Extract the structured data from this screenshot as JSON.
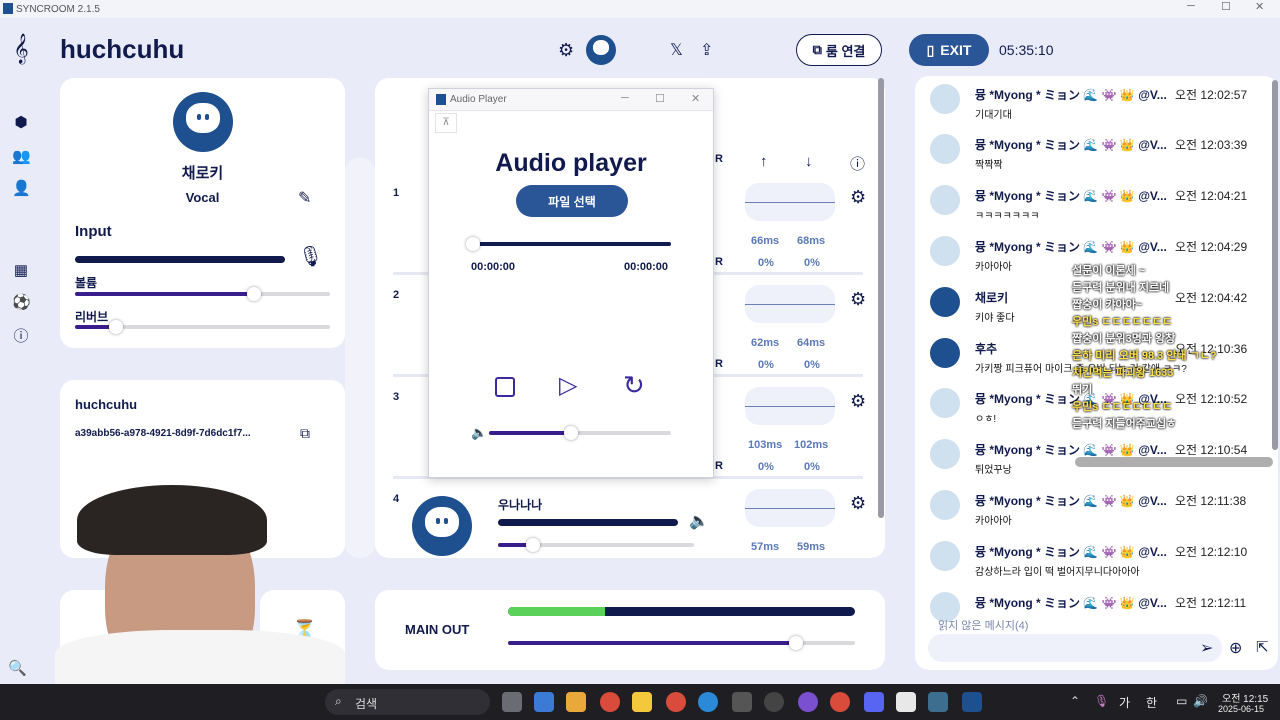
{
  "window": {
    "title": "SYNCROOM 2.1.5",
    "minimize": "─",
    "maximize": "☐",
    "close": "✕"
  },
  "header": {
    "room_name": "huchcuhu",
    "room_connect_label": "룸 연결",
    "exit_label": "EXIT",
    "elapsed_time": "05:35:10"
  },
  "sidebar": {
    "icons": [
      "cube-icon",
      "users-icon",
      "user-icon",
      "calendar-icon",
      "soccer-ball-icon",
      "help-icon"
    ]
  },
  "self": {
    "name": "채로키",
    "role": "Vocal",
    "input_label": "Input",
    "volume_label": "볼륨",
    "volume": 0.7,
    "reverb_label": "리버브",
    "reverb": 0.16,
    "input_level": 0.95
  },
  "room_info": {
    "name": "huchcuhu",
    "id": "a39abb56-a978-4921-8d9f-7d6dc1f7..."
  },
  "members": [
    {
      "number": "1",
      "letter_v": "V",
      "letter_r": "R",
      "ping_a": "66ms",
      "ping_b": "68ms",
      "loss_a": "0%",
      "loss_b": "0%"
    },
    {
      "number": "2",
      "letter_v": "V",
      "letter_r": "R",
      "ping_a": "62ms",
      "ping_b": "64ms",
      "loss_a": "0%",
      "loss_b": "0%"
    },
    {
      "number": "3",
      "letter_v": "V",
      "letter_r": "R",
      "ping_a": "103ms",
      "ping_b": "102ms",
      "loss_a": "0%",
      "loss_b": "0%"
    },
    {
      "number": "4",
      "name": "우나나나",
      "ping_a": "57ms",
      "ping_b": "59ms",
      "volume": 0.18
    }
  ],
  "top_header_letter": "R",
  "main_out": {
    "label": "MAIN OUT",
    "level": 0.28,
    "volume": 0.83
  },
  "audio_player": {
    "window_title": "Audio Player",
    "title": "Audio player",
    "select_file_label": "파일 선택",
    "time_current": "00:00:00",
    "time_total": "00:00:00",
    "volume": 0.45
  },
  "chat": {
    "messages": [
      {
        "name": "뮹 *Myong * ミョン 🌊 👾 👑 @V...",
        "time": "오전  12:02:57",
        "text": "기대기대"
      },
      {
        "name": "뮹 *Myong * ミョン 🌊 👾 👑 @V...",
        "time": "오전  12:03:39",
        "text": "짝짝짝"
      },
      {
        "name": "뮹 *Myong * ミョン 🌊 👾 👑 @V...",
        "time": "오전  12:04:21",
        "text": "ㅋㅋㅋㅋㅋㅋㅋ"
      },
      {
        "name": "뮹 *Myong * ミョン 🌊 👾 👑 @V...",
        "time": "오전  12:04:29",
        "text": "카아아아"
      },
      {
        "name": "채로키",
        "time": "오전  12:04:42",
        "text": "키야 좋다"
      },
      {
        "name": "후추",
        "time": "오전  12:10:36",
        "text": "가키짱 피크퓨어 마이크 좀 오버 되는 거 같애 ㅋㅋ?"
      },
      {
        "name": "뮹 *Myong * ミョン 🌊 👾 👑 @V...",
        "time": "오전  12:10:52",
        "text": "ㅇㅎ!"
      },
      {
        "name": "뮹 *Myong * ミョン 🌊 👾 👑 @V...",
        "time": "오전  12:10:54",
        "text": "튀었꾸낭"
      },
      {
        "name": "뮹 *Myong * ミョン 🌊 👾 👑 @V...",
        "time": "오전  12:11:38",
        "text": "카아아아"
      },
      {
        "name": "뮹 *Myong * ミョン 🌊 👾 👑 @V...",
        "time": "오전  12:12:10",
        "text": "감상하느라 입이 떡 벌어지무니다아아아"
      },
      {
        "name": "뮹 *Myong * ミョン 🌊 👾 👑 @V...",
        "time": "오전  12:12:11",
        "text": ""
      }
    ],
    "unread_label": "읽지 않은 메시지(4)"
  },
  "stream_overlay": [
    {
      "text": "설문이 이론세 ~",
      "color": "#ffffff"
    },
    {
      "text": "듣구력 분위내 지르네",
      "color": "#ffffff"
    },
    {
      "text": "쨥숭이 캬아아~",
      "color": "#ffffff"
    },
    {
      "text": "우민s  ㄷㄷㄷㄷㄷㄷㄷ",
      "color": "#ffe24a"
    },
    {
      "text": "쨥숭이 분위3명과 왕창",
      "color": "#ffffff"
    },
    {
      "text": "은하 미리 오버 98.3 안내 ㄱㄴ?",
      "color": "#ffe24a"
    },
    {
      "text": "치킨먹는 파괴왕 1633",
      "color": "#ffe24a"
    },
    {
      "text": "뛰기",
      "color": "#ffffff"
    },
    {
      "text": "우민s  ㄷㄷㄷㄷㄷㄷㄷ",
      "color": "#ffe24a"
    },
    {
      "text": "듣구력 지들어주교십ㅎ",
      "color": "#ffffff"
    }
  ],
  "taskbar": {
    "search_label": "검색",
    "ime_label": "가",
    "ime_mode": "한",
    "time": "오전 12:15",
    "date": "2025-06-15"
  },
  "colors": {
    "navy": "#111a4d",
    "accent_blue": "#1e4f8f",
    "exit_bg": "#2a5596",
    "purple": "#3a1d8c",
    "green": "#5ad25a"
  }
}
